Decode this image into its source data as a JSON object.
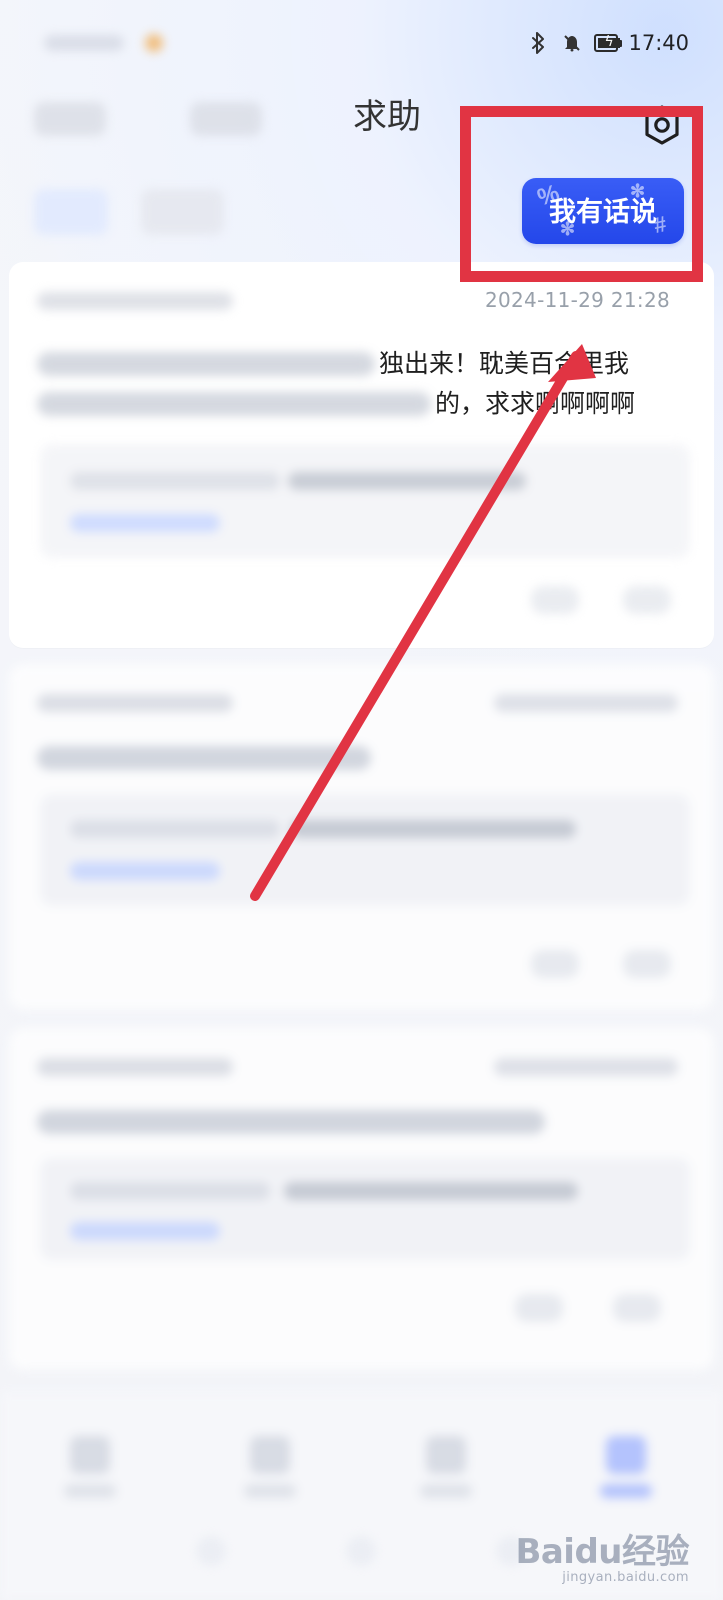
{
  "status_bar": {
    "time": "17:40",
    "icons": [
      "bluetooth-icon",
      "mute-icon",
      "battery-charging-icon"
    ]
  },
  "header": {
    "active_tab": "求助",
    "settings_icon": "settings-icon"
  },
  "actions": {
    "speak_button_label": "我有话说",
    "speak_button_color": "#2f54f0",
    "annotation_color": "#e13443"
  },
  "posts": [
    {
      "timestamp": "2024-11-29 21:28",
      "title_line_1_visible": "独出来！耽美百合里我",
      "title_line_2_visible": "的，求求啊啊啊啊"
    }
  ],
  "watermark": {
    "main": "Baidu经验",
    "sub": "jingyan.baidu.com"
  }
}
